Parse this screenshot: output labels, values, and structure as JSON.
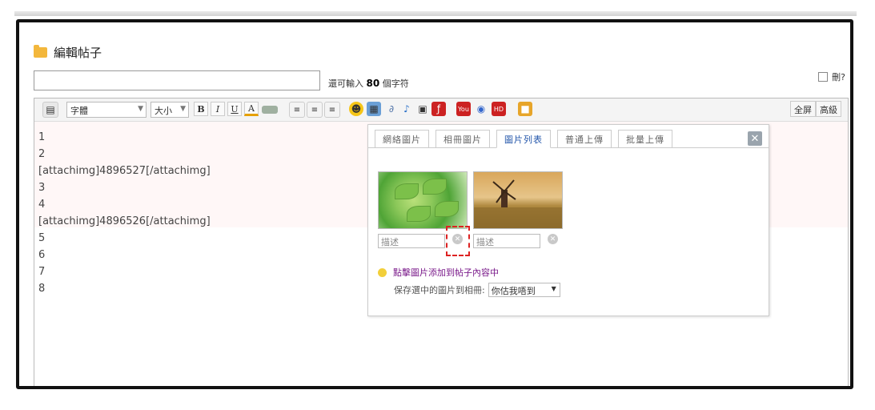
{
  "page_title": "編輯帖子",
  "title_input": {
    "value": ""
  },
  "char_hint": {
    "prefix": "還可輸入",
    "count": "80",
    "suffix": "個字符"
  },
  "delete_checkbox_label": "刪?",
  "toolbar": {
    "font_select": "字體",
    "size_select": "大小",
    "bold": "B",
    "italic": "I",
    "underline": "U",
    "fontcolor": "A",
    "fullscreen": "全屏",
    "advanced": "高級"
  },
  "editor_lines": [
    "1",
    "2",
    "[attachimg]4896527[/attachimg]",
    "3",
    "4",
    "[attachimg]4896526[/attachimg]",
    "5",
    "6",
    "7",
    "8"
  ],
  "popup": {
    "tabs": [
      "網絡圖片",
      "相冊圖片",
      "圖片列表",
      "普通上傳",
      "批量上傳"
    ],
    "active_tab": "圖片列表",
    "close": "✕",
    "images": [
      {
        "desc_placeholder": "描述"
      },
      {
        "desc_placeholder": "描述"
      }
    ],
    "tip": "點擊圖片添加到帖子內容中",
    "save_label": "保存選中的圖片到相冊:",
    "album_selected": "你估我唔到"
  },
  "colors": {
    "folder": "#f3b73c",
    "highlight": "#d22222",
    "tab_active_text": "#2255aa",
    "tip_text": "#7a1a8a"
  }
}
